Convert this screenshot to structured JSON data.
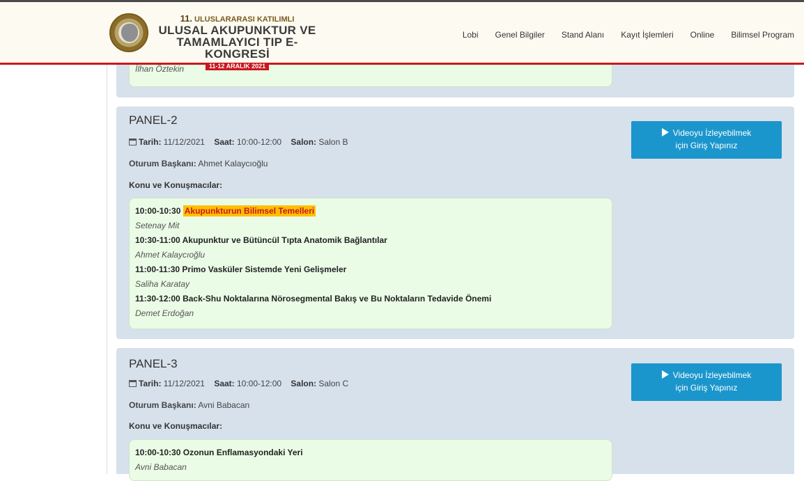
{
  "header": {
    "logo_line1_num": "11.",
    "logo_line1": "ULUSLARARASI KATILIMLI",
    "logo_line2": "ULUSAL AKUPUNKTUR VE",
    "logo_line3": "TAMAMLAYICI TIP E-KONGRESİ",
    "logo_dates": "11-12 ARALIK 2021",
    "nav": [
      "Lobi",
      "Genel Bilgiler",
      "Stand Alanı",
      "Kayıt İşlemleri",
      "Online",
      "Bilimsel Program"
    ]
  },
  "prev_panel": {
    "speaker": "İlhan Öztekin"
  },
  "panels": [
    {
      "title": "PANEL-2",
      "tarih_label": "Tarih:",
      "tarih": "11/12/2021",
      "saat_label": "Saat:",
      "saat": "10:00-12:00",
      "salon_label": "Salon:",
      "salon": "Salon B",
      "chair_label": "Oturum Başkanı:",
      "chair": "Ahmet Kalaycıoğlu",
      "konu_label": "Konu ve Konuşmacılar:",
      "talks": [
        {
          "time": "10:00-10:30",
          "title": "Akupunkturun Bilimsel Temelleri",
          "speaker": "Setenay Mit"
        },
        {
          "time": "10:30-11:00",
          "title": "Akupunktur ve Bütüncül Tıpta Anatomik Bağlantılar",
          "speaker": "Ahmet Kalaycıoğlu"
        },
        {
          "time": "11:00-11:30",
          "title": "Primo Vasküler Sistemde Yeni Gelişmeler",
          "speaker": "Saliha Karatay"
        },
        {
          "time": "11:30-12:00",
          "title": "Back-Shu Noktalarına Nörosegmental Bakış ve Bu Noktaların Tedavide Önemi",
          "speaker": "Demet Erdoğan"
        }
      ],
      "button_line1": "Videoyu İzleyebilmek",
      "button_line2": "için Giriş Yapınız"
    },
    {
      "title": "PANEL-3",
      "tarih_label": "Tarih:",
      "tarih": "11/12/2021",
      "saat_label": "Saat:",
      "saat": "10:00-12:00",
      "salon_label": "Salon:",
      "salon": "Salon C",
      "chair_label": "Oturum Başkanı:",
      "chair": "Avni Babacan",
      "konu_label": "Konu ve Konuşmacılar:",
      "talks": [
        {
          "time": "10:00-10:30",
          "title": "Ozonun Enflamasyondaki Yeri",
          "speaker": "Avni Babacan"
        }
      ],
      "button_line1": "Videoyu İzleyebilmek",
      "button_line2": "için Giriş Yapınız"
    }
  ],
  "colors": {
    "accent_red": "#c9171e",
    "button_blue": "#1b96cc",
    "panel_bg": "#d6e1ec",
    "talk_bg": "#eafbe6",
    "highlight": "#ffc000"
  }
}
